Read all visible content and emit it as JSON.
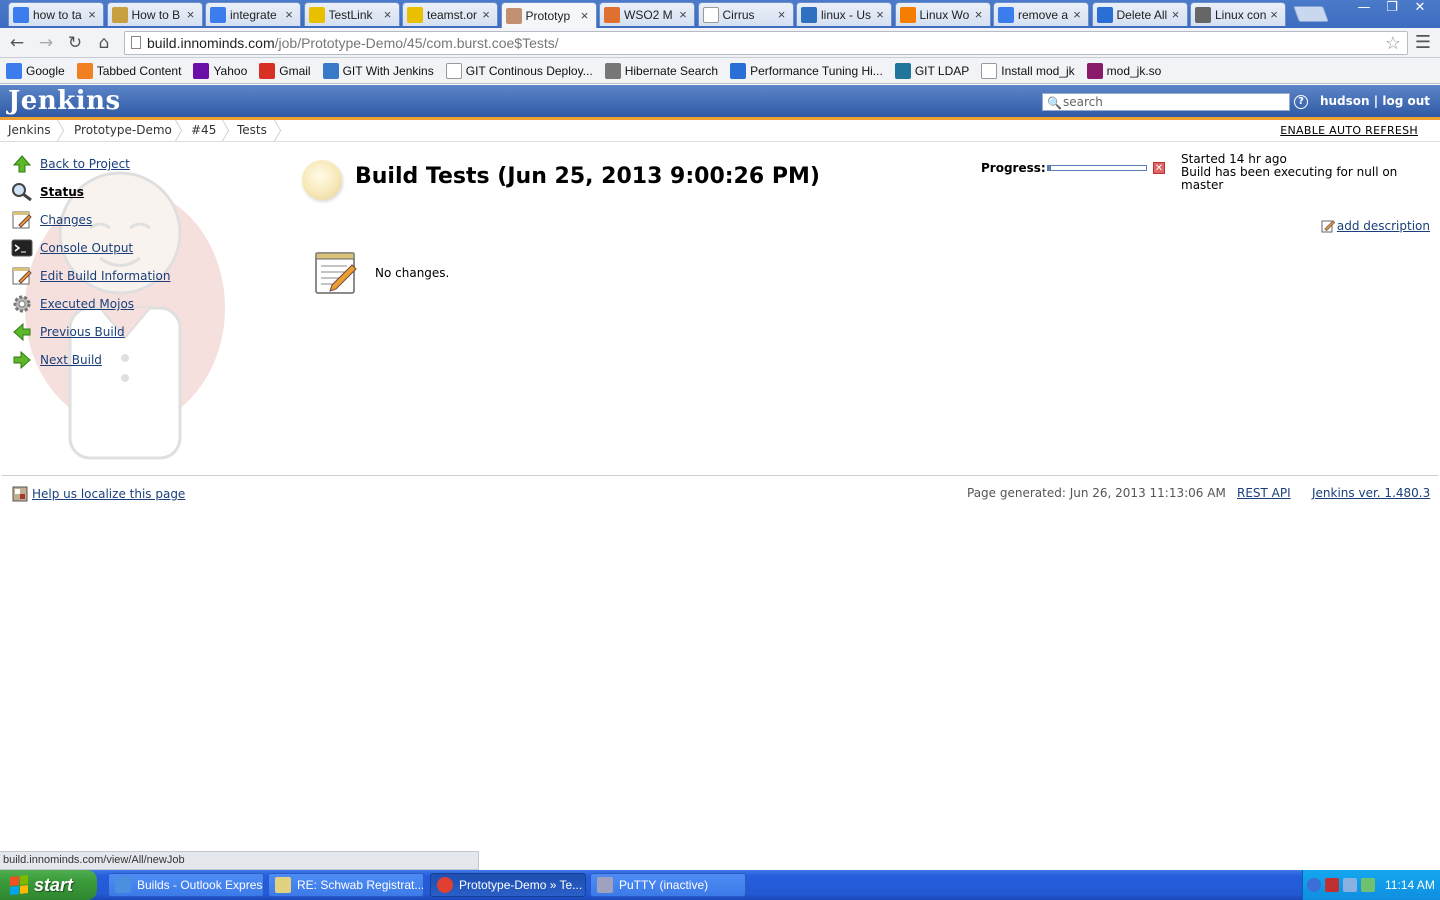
{
  "browser": {
    "tabs": [
      {
        "label": "how to ta",
        "icon": "google-icon",
        "color": "#3b7ded",
        "active": false
      },
      {
        "label": "How to B",
        "icon": "disc-icon",
        "color": "#c8a040",
        "active": false
      },
      {
        "label": "integrate",
        "icon": "google-icon",
        "color": "#3b7ded",
        "active": false
      },
      {
        "label": "TestLink",
        "icon": "testlink-icon",
        "color": "#e8c000",
        "active": false
      },
      {
        "label": "teamst.or",
        "icon": "testlink-icon",
        "color": "#e8c000",
        "active": false
      },
      {
        "label": "Prototyp",
        "icon": "jenkins-icon",
        "color": "#c09070",
        "active": true
      },
      {
        "label": "WSO2 M",
        "icon": "wso2-icon",
        "color": "#e07030",
        "active": false
      },
      {
        "label": "Cirrus",
        "icon": "page-icon",
        "color": "#ffffff",
        "active": false
      },
      {
        "label": "linux - Us",
        "icon": "serverfault-icon",
        "color": "#3070c0",
        "active": false
      },
      {
        "label": "Linux Wo",
        "icon": "blogger-icon",
        "color": "#f57d00",
        "active": false
      },
      {
        "label": "remove a",
        "icon": "google-icon",
        "color": "#3b7ded",
        "active": false
      },
      {
        "label": "Delete All",
        "icon": "app-icon",
        "color": "#2a6fd6",
        "active": false
      },
      {
        "label": "Linux con",
        "icon": "wikipedia-icon",
        "color": "#666666",
        "active": false
      }
    ],
    "url_host": "build.innominds.com",
    "url_path": "/job/Prototype-Demo/45/com.burst.coe$Tests/",
    "bookmarks": [
      {
        "label": "Google",
        "icon": "google-icon",
        "color": "#3b7ded"
      },
      {
        "label": "Tabbed Content",
        "icon": "stripes-icon",
        "color": "#f08020"
      },
      {
        "label": "Yahoo",
        "icon": "yahoo-icon",
        "color": "#6b0fa8"
      },
      {
        "label": "Gmail",
        "icon": "gmail-icon",
        "color": "#d93025"
      },
      {
        "label": "GIT With Jenkins",
        "icon": "info-icon",
        "color": "#3a78c8"
      },
      {
        "label": "GIT Continous Deploy...",
        "icon": "page-icon",
        "color": "#ffffff"
      },
      {
        "label": "Hibernate Search",
        "icon": "jboss-icon",
        "color": "#777777"
      },
      {
        "label": "Performance Tuning Hi...",
        "icon": "doc-icon",
        "color": "#2a6fd6"
      },
      {
        "label": "GIT LDAP",
        "icon": "wordpress-icon",
        "color": "#21759b"
      },
      {
        "label": "Install mod_jk",
        "icon": "page-icon",
        "color": "#ffffff"
      },
      {
        "label": "mod_jk.so",
        "icon": "feather-icon",
        "color": "#8a1a6a"
      }
    ]
  },
  "jenkins": {
    "logo": "Jenkins",
    "search_placeholder": "search",
    "help": "?",
    "user": "hudson",
    "separator": "|",
    "logout": "log out",
    "breadcrumbs": [
      "Jenkins",
      "Prototype-Demo",
      "#45",
      "Tests"
    ],
    "auto_refresh": "ENABLE AUTO REFRESH"
  },
  "sidebar": {
    "tasks": [
      {
        "label": "Back to Project",
        "icon": "up-arrow-icon",
        "bold": false
      },
      {
        "label": "Status",
        "icon": "search-icon",
        "bold": true
      },
      {
        "label": "Changes",
        "icon": "notepad-icon",
        "bold": false
      },
      {
        "label": "Console Output",
        "icon": "terminal-icon",
        "bold": false
      },
      {
        "label": "Edit Build Information",
        "icon": "notepad-icon",
        "bold": false
      },
      {
        "label": "Executed Mojos",
        "icon": "gear-icon",
        "bold": false
      },
      {
        "label": "Previous Build",
        "icon": "left-arrow-icon",
        "bold": false
      },
      {
        "label": "Next Build",
        "icon": "right-arrow-icon",
        "bold": false
      }
    ]
  },
  "main": {
    "title": "Build Tests (Jun 25, 2013 9:00:26 PM)",
    "progress_label": "Progress:",
    "progress_fraction": 0.03,
    "started": "Started 14 hr ago",
    "executing": "Build has been executing for null on master",
    "add_description": "add description",
    "no_changes": "No changes."
  },
  "footer": {
    "localize": "Help us localize this page",
    "page_generated": "Page generated: Jun 26, 2013 11:13:06 AM",
    "rest_api": "REST API",
    "version": "Jenkins ver. 1.480.3"
  },
  "status_bubble": "build.innominds.com/view/All/newJob",
  "taskbar": {
    "start": "start",
    "items": [
      {
        "label": "Builds - Outlook Express",
        "icon": "outlook-icon",
        "active": false
      },
      {
        "label": "RE: Schwab Registrat...",
        "icon": "mail-icon",
        "active": false
      },
      {
        "label": "Prototype-Demo » Te...",
        "icon": "chrome-icon",
        "active": true
      },
      {
        "label": "PuTTY (inactive)",
        "icon": "putty-icon",
        "active": false
      }
    ],
    "clock": "11:14 AM"
  }
}
